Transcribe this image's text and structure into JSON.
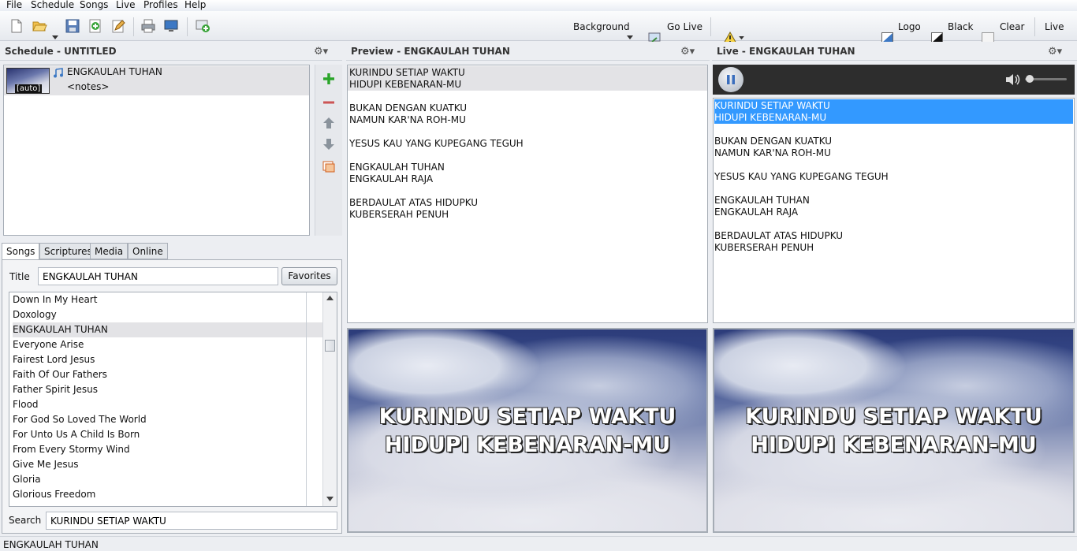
{
  "menu": [
    "File",
    "Schedule",
    "Songs",
    "Live",
    "Profiles",
    "Help"
  ],
  "toolbar": {
    "background_label": "Background",
    "go_live_label": "Go Live",
    "logo_label": "Logo",
    "black_label": "Black",
    "clear_label": "Clear",
    "live_label": "Live"
  },
  "schedule": {
    "title": "Schedule - UNTITLED",
    "item_title": "ENGKAULAH TUHAN",
    "item_notes": "<notes>",
    "thumb_label": "[auto]"
  },
  "preview": {
    "title": "Preview - ENGKAULAH TUHAN",
    "lyrics": [
      [
        "KURINDU SETIAP WAKTU",
        "HIDUPI KEBENARAN-MU"
      ],
      [
        "BUKAN DENGAN KUATKU",
        "NAMUN KAR'NA ROH-MU"
      ],
      [
        "YESUS KAU YANG KUPEGANG TEGUH"
      ],
      [
        "ENGKAULAH TUHAN",
        "ENGKAULAH RAJA"
      ],
      [
        "BERDAULAT ATAS HIDUPKU",
        "KUBERSERAH PENUH"
      ]
    ],
    "slide_line1": "KURINDU SETIAP WAKTU",
    "slide_line2": "HIDUPI KEBENARAN-MU"
  },
  "live": {
    "title": "Live - ENGKAULAH TUHAN",
    "slide_line1": "KURINDU SETIAP WAKTU",
    "slide_line2": "HIDUPI KEBENARAN-MU"
  },
  "library": {
    "tabs": [
      "Songs",
      "Scriptures",
      "Media",
      "Online"
    ],
    "title_label": "Title",
    "title_value": "ENGKAULAH TUHAN",
    "favorites_label": "Favorites",
    "songs": [
      "Down In My Heart",
      "Doxology",
      "ENGKAULAH TUHAN",
      "Everyone Arise",
      "Fairest Lord Jesus",
      "Faith Of Our Fathers",
      "Father Spirit Jesus",
      "Flood",
      "For God So Loved The World",
      "For Unto Us A Child Is Born",
      "From Every Stormy Wind",
      "Give Me Jesus",
      "Gloria",
      "Glorious Freedom"
    ],
    "selected_index": 2,
    "search_label": "Search",
    "search_value": "KURINDU SETIAP WAKTU"
  },
  "status": "ENGKAULAH TUHAN",
  "colors": {
    "selection": "#3399ff",
    "row_selected": "#e3e3e6",
    "add_green": "#2aa52a"
  },
  "icons": [
    "new-file-icon",
    "open-folder-icon",
    "save-icon",
    "add-icon",
    "edit-icon",
    "print-icon",
    "monitor-icon",
    "add-screen-icon",
    "warning-icon",
    "gear-icon",
    "pause-icon",
    "volume-icon"
  ]
}
